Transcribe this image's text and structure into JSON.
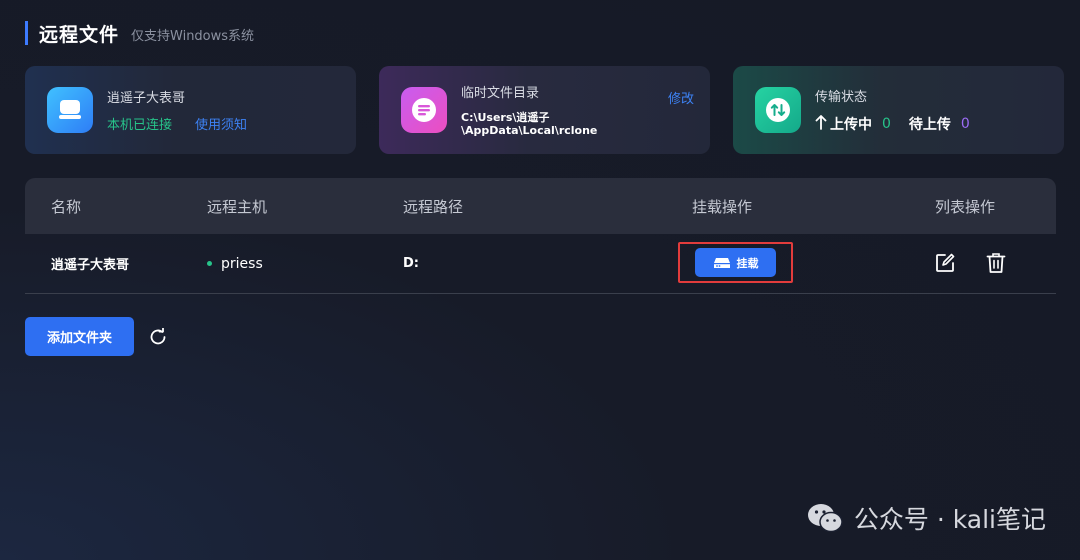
{
  "header": {
    "title": "远程文件",
    "subtitle": "仅支持Windows系统",
    "accent_color": "#3d7bff"
  },
  "cards": {
    "connection": {
      "icon": "device-icon",
      "title": "逍遥子大表哥",
      "status": "本机已连接",
      "status_color": "#27c38a",
      "link": "使用须知",
      "link_color": "#3d82f4"
    },
    "temp_dir": {
      "icon": "list-doc-icon",
      "title": "临时文件目录",
      "path_line1": "C:\\Users\\逍遥子",
      "path_line2": "\\AppData\\Local\\rclone",
      "edit_label": "修改"
    },
    "transfer": {
      "icon": "transfer-arrows-icon",
      "title": "传输状态",
      "uploading_label": "上传中",
      "uploading_count": "0",
      "uploading_color": "#27c38a",
      "pending_label": "待上传",
      "pending_count": "0",
      "pending_color": "#9b6cf5"
    }
  },
  "table": {
    "columns": [
      "名称",
      "远程主机",
      "远程路径",
      "挂载操作",
      "列表操作"
    ],
    "rows": [
      {
        "name": "逍遥子大表哥",
        "host": "priess",
        "host_status_color": "#27c38a",
        "path": "D:",
        "mount_label": "挂载"
      }
    ]
  },
  "actions": {
    "add_folder_label": "添加文件夹"
  },
  "watermark": {
    "text": "公众号 · kali笔记"
  }
}
